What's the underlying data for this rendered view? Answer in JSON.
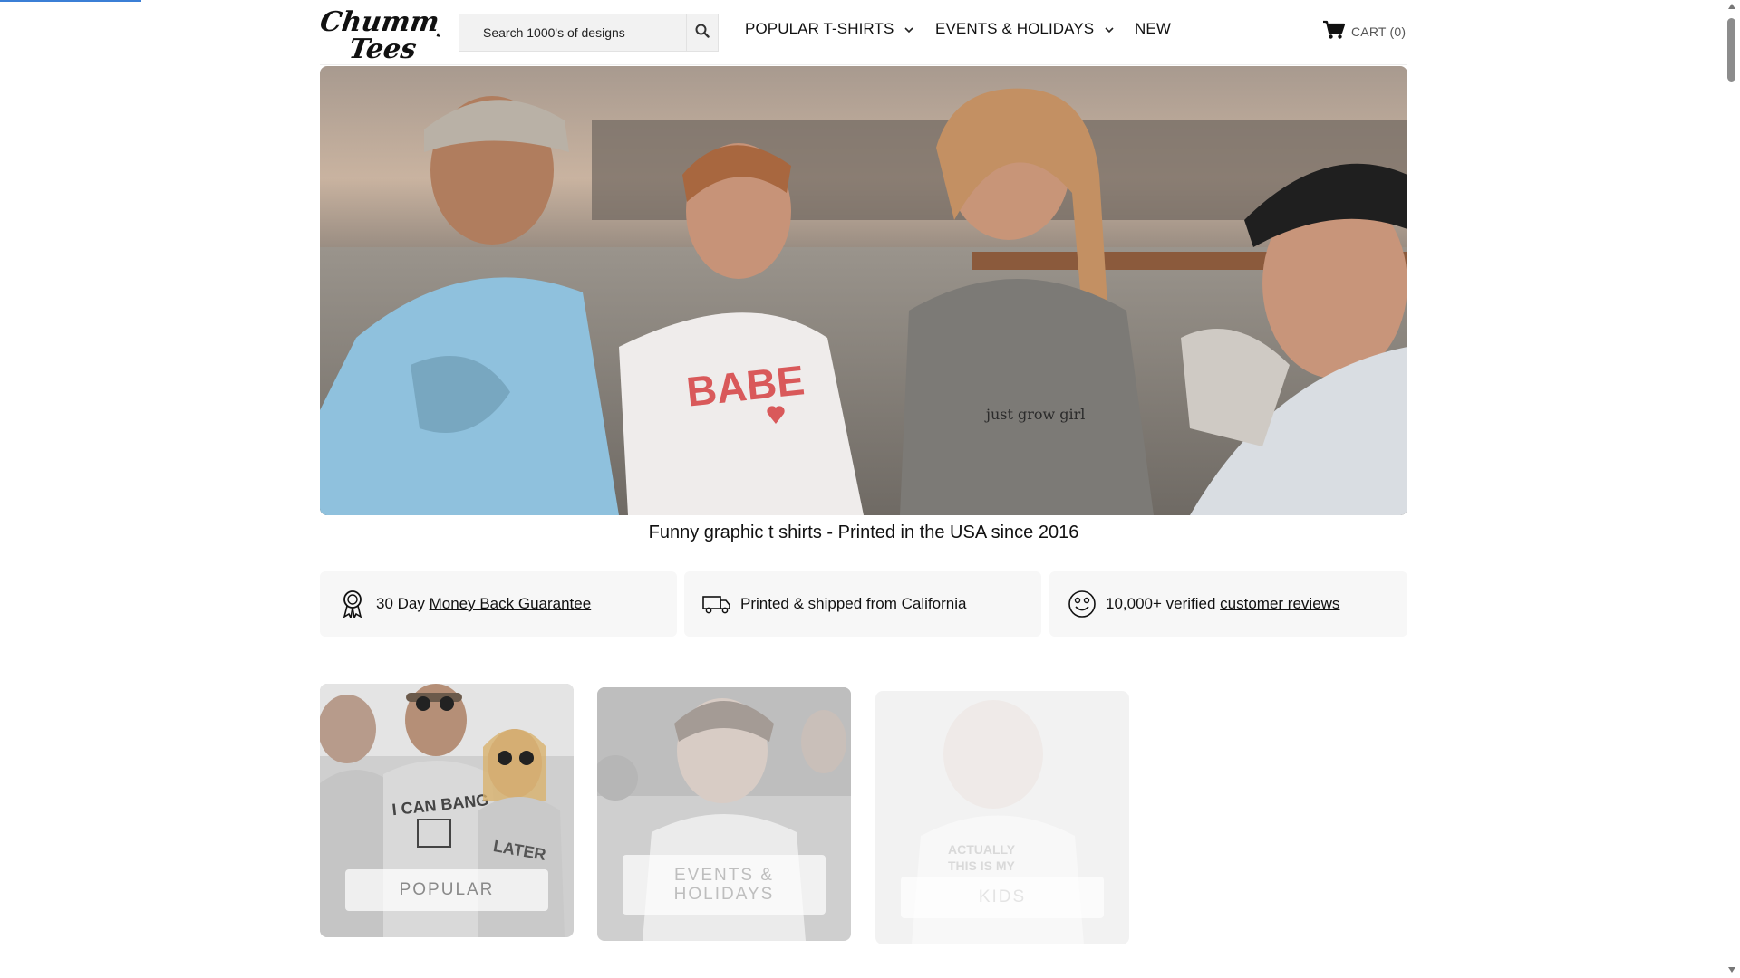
{
  "brand": {
    "logo_text": "Chummy Tees"
  },
  "search": {
    "placeholder": "Search 1000's of designs",
    "button_icon": "search-icon"
  },
  "nav": {
    "items": [
      {
        "label": "POPULAR T-SHIRTS",
        "has_dropdown": true
      },
      {
        "label": "EVENTS & HOLIDAYS",
        "has_dropdown": true
      },
      {
        "label": "NEW",
        "has_dropdown": false
      }
    ]
  },
  "cart": {
    "label": "CART",
    "count": "(0)",
    "icon": "cart-icon"
  },
  "hero": {
    "alt": "Friends laughing on rooftop wearing graphic t-shirts"
  },
  "tagline": "Funny graphic t shirts - Printed in the USA since 2016",
  "benefits": [
    {
      "icon": "award-ribbon-icon",
      "prefix": "30 Day ",
      "link": "Money Back Guarantee"
    },
    {
      "icon": "delivery-truck-icon",
      "prefix": "Printed & shipped from California",
      "link": ""
    },
    {
      "icon": "smiley-face-icon",
      "prefix": "10,000+ verified ",
      "link": "customer reviews"
    }
  ],
  "categories": [
    {
      "label": "POPULAR"
    },
    {
      "label_line1": "EVENTS &",
      "label_line2": "HOLIDAYS"
    },
    {
      "label": "KIDS"
    }
  ],
  "colors": {
    "accent_progress": "#3b7fd6",
    "benefit_bg": "#f7f7f7",
    "search_bg": "#f2f2f2"
  }
}
